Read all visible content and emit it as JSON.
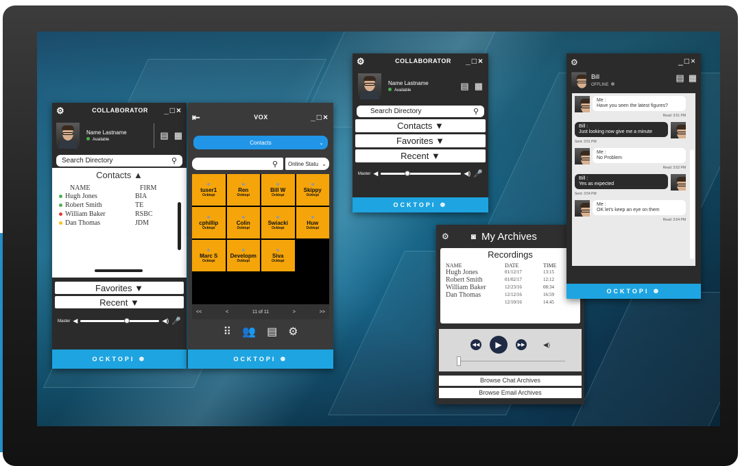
{
  "collab1": {
    "title": "COLLABORATOR",
    "controls": "_□×",
    "user_name": "Name Lastname",
    "user_status": "Available",
    "search_placeholder": "Search Directory",
    "contacts_label": "Contacts ▲",
    "col_name": "NAME",
    "col_firm": "FIRM",
    "contacts": [
      {
        "name": "Hugh Jones",
        "firm": "BIA",
        "status_color": "#4caf50"
      },
      {
        "name": "Robert Smith",
        "firm": "TE",
        "status_color": "#4caf50"
      },
      {
        "name": "William Baker",
        "firm": "RSBC",
        "status_color": "#e53935"
      },
      {
        "name": "Dan Thomas",
        "firm": "JDM",
        "status_color": "#f5c518"
      }
    ],
    "favorites_label": "Favorites ▼",
    "recent_label": "Recent ▼",
    "master_label": "Master",
    "brand": "OCKTOPI"
  },
  "vox": {
    "title": "VOX",
    "controls": "_□×",
    "dropdown_label": "Contacts",
    "status_filter": "Online Statu",
    "tiles": [
      {
        "name": "tuser1",
        "sub": "Ocktopi"
      },
      {
        "name": "Ren",
        "sub": "Ocktopi"
      },
      {
        "name": "Bill W",
        "sub": "Ocktopi"
      },
      {
        "name": "Skippy",
        "sub": "Ocktopi"
      },
      {
        "name": "cphillip",
        "sub": "Ocktopi"
      },
      {
        "name": "Colin",
        "sub": "Ocktopi"
      },
      {
        "name": "Swiacki",
        "sub": "Ocktopi"
      },
      {
        "name": "Huw",
        "sub": "Ocktopi"
      },
      {
        "name": "Marc S",
        "sub": "Ocktopi"
      },
      {
        "name": "Developm",
        "sub": "Ocktopi"
      },
      {
        "name": "Siva",
        "sub": "Ocktopi"
      }
    ],
    "pager": {
      "first": "<<",
      "prev": "<",
      "page": "11 of 11",
      "next": ">",
      "last": ">>"
    },
    "brand": "OCKTOPI",
    "tile_color": "#f5a50a"
  },
  "collab2": {
    "title": "COLLABORATOR",
    "controls": "_□×",
    "user_name": "Name Lastname",
    "user_status": "Available",
    "search_placeholder": "Search Directory",
    "contacts_label": "Contacts ▼",
    "favorites_label": "Favorites ▼",
    "recent_label": "Recent ▼",
    "master_label": "Master",
    "brand": "OCKTOPI"
  },
  "archives": {
    "title": "My Archives",
    "section": "Recordings",
    "headers": [
      "NAME",
      "DATE",
      "TIME"
    ],
    "rows": [
      [
        "Hugh Jones",
        "01/12/17",
        "13:15"
      ],
      [
        "Robert Smith",
        "01/02/17",
        "12:12"
      ],
      [
        "William Baker",
        "12/23/16",
        "08:34"
      ],
      [
        "Dan Thomas",
        "12/12/16",
        "16:59"
      ],
      [
        "",
        "12/10/16",
        "14:45"
      ]
    ],
    "browse_chat": "Browse Chat Archives",
    "browse_email": "Browse Email Archives"
  },
  "chat": {
    "contact_name": "Bill",
    "contact_status": "OFFLINE",
    "controls": "_□×",
    "messages": [
      {
        "from": "me",
        "sender": "Me :",
        "text": "Have you seen the latest figures?",
        "meta": "Read: 3:51 PM"
      },
      {
        "from": "bill",
        "sender": "Bill :",
        "text": "Just looking now give me a minute",
        "meta": "Sent: 3:51 PM"
      },
      {
        "from": "me",
        "sender": "Me :",
        "text": "No Problem",
        "meta": "Read: 3:52 PM"
      },
      {
        "from": "bill",
        "sender": "Bill :",
        "text": "Yes as expected",
        "meta": "Sent: 3:54 PM"
      },
      {
        "from": "me",
        "sender": "Me :",
        "text": "OK let's keep an eye on them",
        "meta": "Read: 3:54 PM"
      }
    ],
    "brand": "OCKTOPI"
  }
}
